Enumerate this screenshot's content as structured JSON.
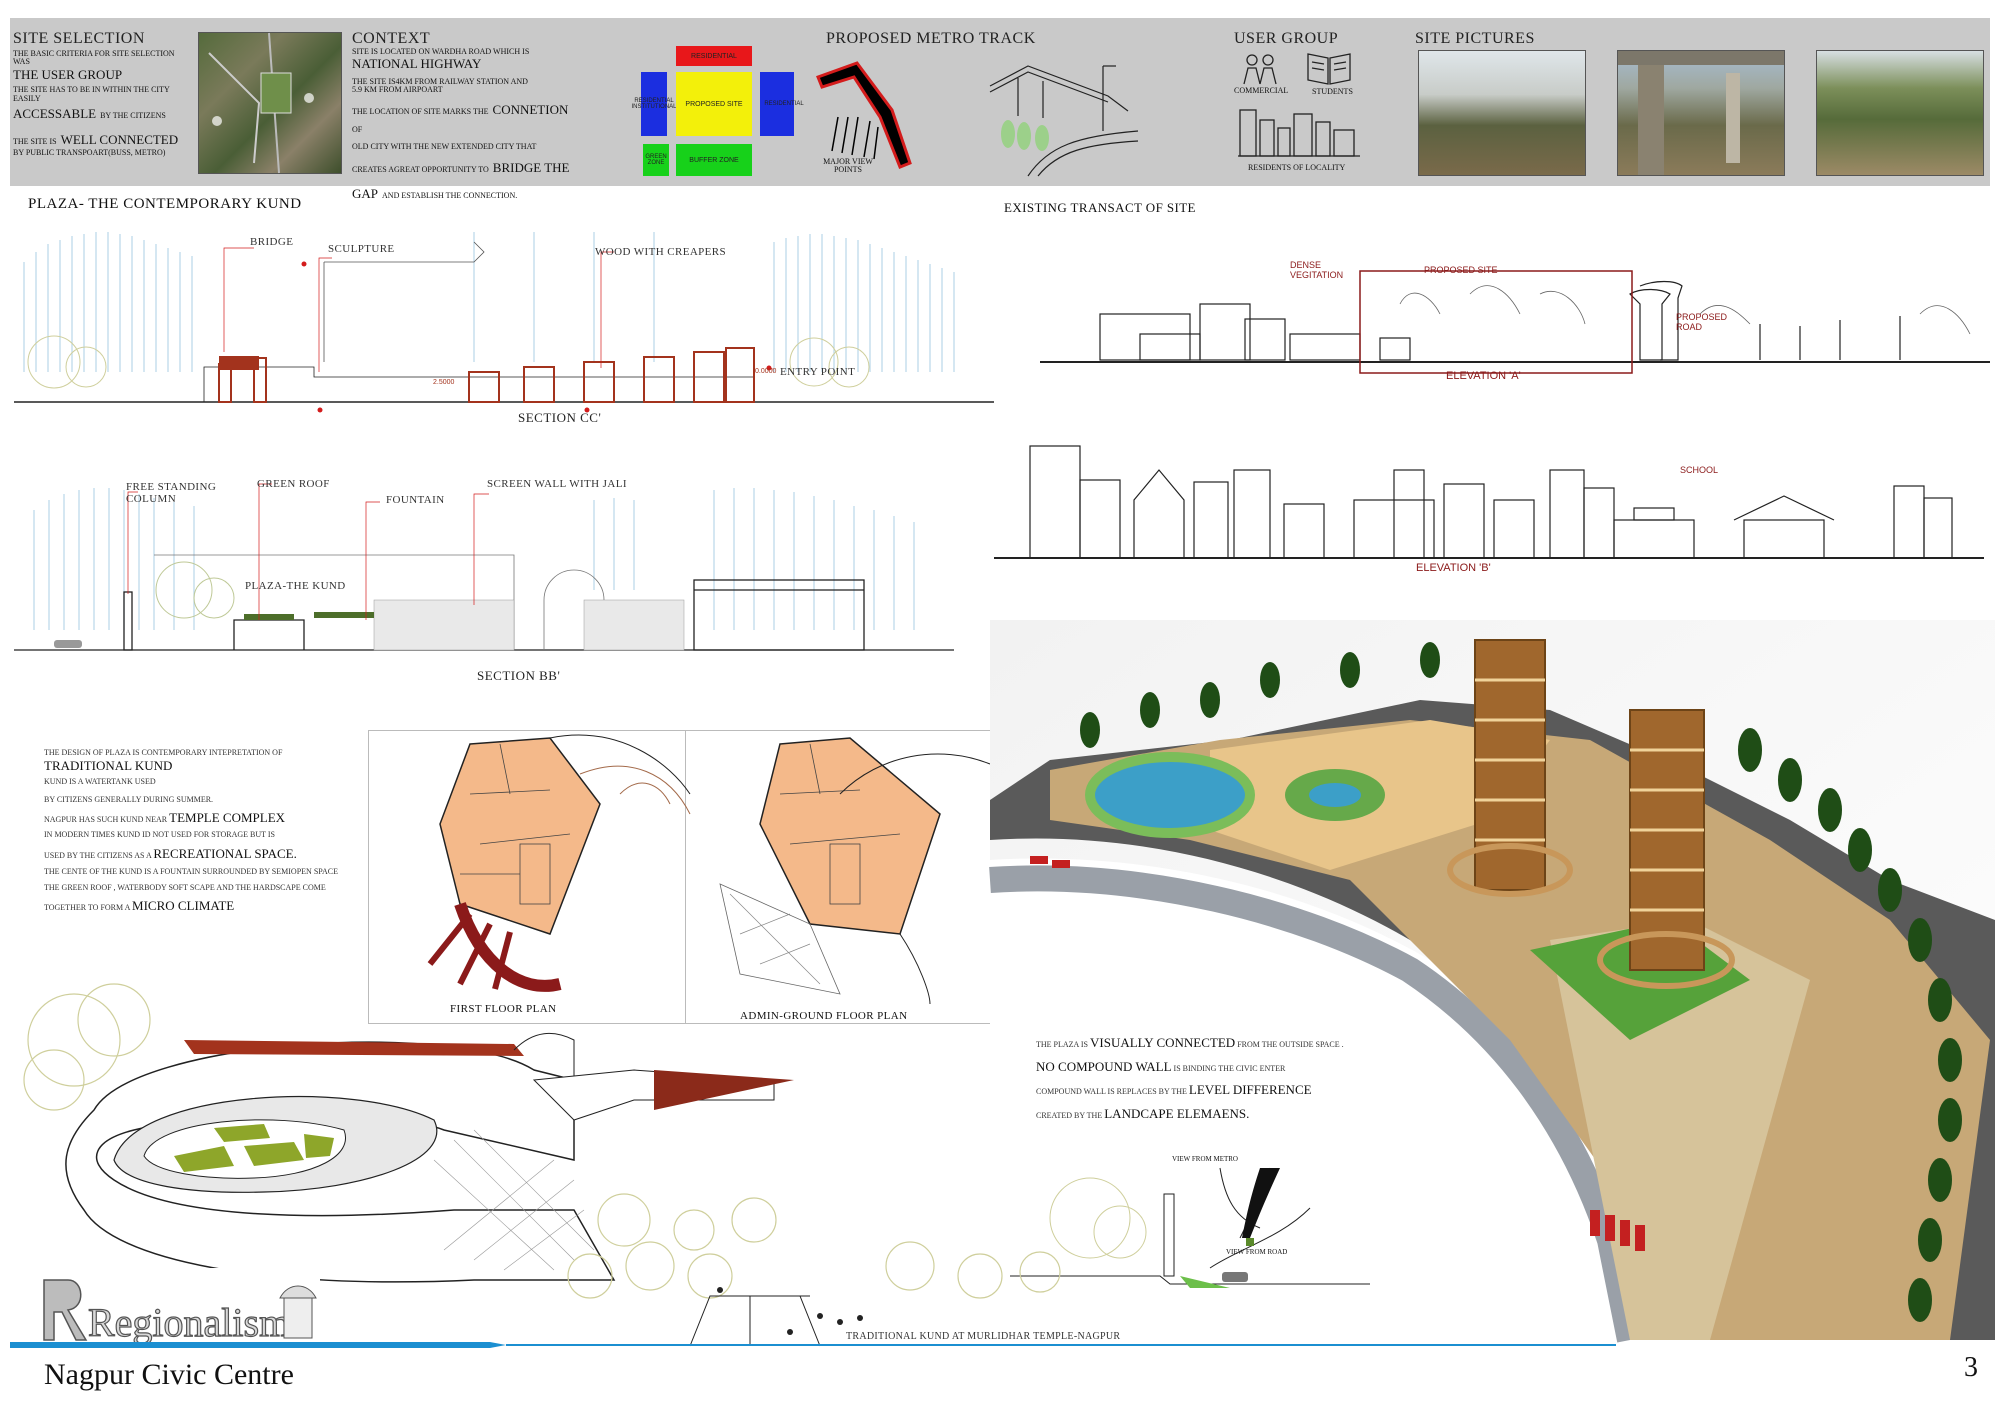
{
  "colors": {
    "band": "#c9c9c9",
    "accent_red": "#a3331d",
    "footer_blue": "#1b8fd1",
    "render_bg": "#f3e8cf"
  },
  "site_selection": {
    "title": "SITE SELECTION",
    "line1": "THE BASIC CRITERIA FOR SITE SELECTION WAS",
    "line2": "THE USER GROUP",
    "line3": "THE SITE HAS TO BE IN WITHIN THE CITY EASILY",
    "line4a": "ACCESSABLE",
    "line4b": "BY THE CITIZENS",
    "line5a": "THE SITE IS",
    "line5b": "WELL CONNECTED",
    "line6": "BY PUBLIC TRANSPOART(BUSS, METRO)"
  },
  "context": {
    "title": "CONTEXT",
    "line1": "SITE IS LOCATED ON WARDHA ROAD WHICH IS",
    "line2": "NATIONAL HIGHWAY",
    "line3": "THE SITE IS4KM FROM RAILWAY STATION AND",
    "line4": "5.9 KM FROM AIRPOART",
    "line5a": "THE LOCATION OF SITE MARKS THE",
    "line5b": "CONNETION",
    "line5c": "OF",
    "line6": "OLD CITY WITH THE NEW EXTENDED CITY THAT",
    "line7a": "CREATES AGREAT OPPORTUNITY TO",
    "line7b": "BRIDGE THE",
    "line8a": "GAP",
    "line8b": "AND ESTABLISH THE CONNECTION."
  },
  "zoning": {
    "residential": "RESIDENTIAL",
    "res_inst": "RESIDENTIAL INSTITUTIONAL",
    "proposed": "PROPOSED SITE",
    "right": "RESIDENTIAL",
    "green": "GREEN ZONE",
    "buffer": "BUFFER ZONE"
  },
  "metro": {
    "title": "PROPOSED METRO TRACK",
    "viewpoints": "MAJOR VIEW POINTS"
  },
  "user_group": {
    "title": "USER GROUP",
    "commercial": "COMMERCIAL",
    "students": "STUDENTS",
    "residents": "RESIDENTS OF LOCALITY"
  },
  "site_pictures": {
    "title": "SITE PICTURES"
  },
  "plaza": {
    "title": "PLAZA- THE CONTEMPORARY KUND"
  },
  "section_cc": {
    "bridge": "BRIDGE",
    "sculpture": "SCULPTURE",
    "wood": "WOOD WITH CREAPERS",
    "entry": "ENTRY POINT",
    "lvl1": "2.5000",
    "lvl2": "0.0000",
    "title": "SECTION CC'"
  },
  "section_bb": {
    "column": "FREE STANDING COLUMN",
    "green_roof": "GREEN ROOF",
    "fountain": "FOUNTAIN",
    "screen": "SCREEN WALL WITH JALI",
    "kund": "PLAZA-THE KUND",
    "title": "SECTION BB'"
  },
  "transect": {
    "title": "EXISTING TRANSACT OF SITE",
    "dense": "DENSE VEGITATION",
    "proposed": "PROPOSED SITE",
    "road": "PROPOSED ROAD",
    "elev_a": "ELEVATION 'A'",
    "school": "SCHOOL",
    "elev_b": "ELEVATION 'B'"
  },
  "design_text": {
    "l1": "THE DESIGN OF PLAZA IS CONTEMPORARY INTEPRETATION OF",
    "l2": "TRADITIONAL KUND",
    "l3": "KUND IS A WATERTANK USED",
    "l4": "BY CITIZENS GENERALLY DURING SUMMER.",
    "l5a": "NAGPUR HAS SUCH KUND NEAR",
    "l5b": "TEMPLE COMPLEX",
    "l6": "IN MODERN TIMES KUND ID NOT USED FOR STORAGE BUT IS",
    "l7a": "USED BY THE CITIZENS AS A",
    "l7b": "RECREATIONAL SPACE.",
    "l8": "THE CENTE OF THE KUND IS A FOUNTAIN SURROUNDED BY SEMIOPEN SPACE",
    "l9": "THE GREEN ROOF , WATERBODY SOFT SCAPE AND THE HARDSCAPE COME",
    "l10a": "TOGETHER TO FORM A",
    "l10b": "MICRO CLIMATE"
  },
  "plans": {
    "first": "FIRST FLOOR PLAN",
    "ground": "ADMIN-GROUND FLOOR PLAN"
  },
  "visual_text": {
    "l1a": "THE PLAZA IS",
    "l1b": "VISUALLY CONNECTED",
    "l1c": "FROM THE OUTSIDE SPACE .",
    "l2a": "NO COMPOUND WALL",
    "l2b": "IS BINDING THE CIVIC ENTER",
    "l3a": "COMPOUND WALL IS REPLACES BY THE",
    "l3b": "LEVEL DIFFERENCE",
    "l4a": "CREATED BY THE",
    "l4b": "LANDCAPE ELEMAENS."
  },
  "views": {
    "metro": "VIEW FROM METRO",
    "road": "VIEW FROM ROAD"
  },
  "kund_caption": "TRADITIONAL KUND AT MURLIDHAR TEMPLE-NAGPUR",
  "footer": {
    "logo": "Regionalism",
    "project": "Nagpur Civic Centre",
    "page": "3"
  }
}
